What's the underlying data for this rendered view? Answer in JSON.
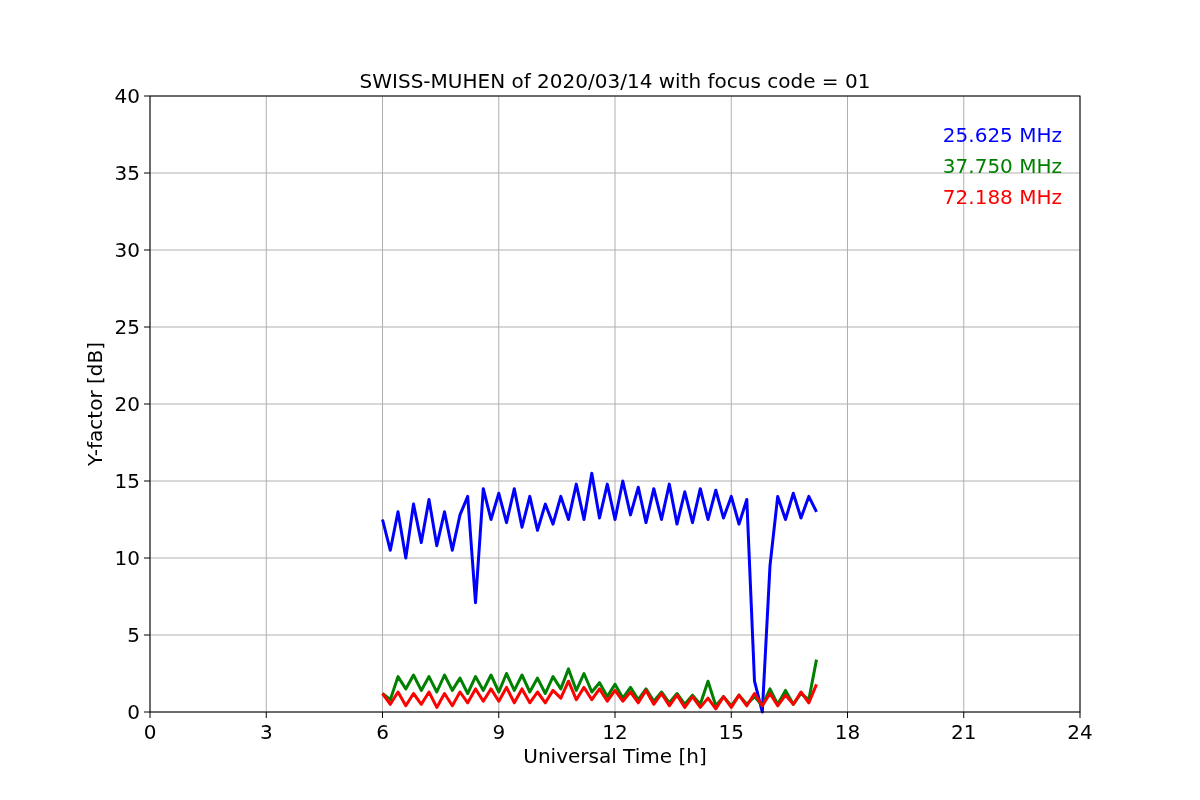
{
  "plot": {
    "chart_data": {
      "type": "line",
      "title": "SWISS-MUHEN of 2020/03/14 with focus code = 01",
      "xlabel": "Universal Time [h]",
      "ylabel": "Y-factor [dB]",
      "x": [
        6,
        6.2,
        6.4,
        6.6,
        6.8,
        7,
        7.2,
        7.4,
        7.6,
        7.8,
        8,
        8.2,
        8.4,
        8.6,
        8.8,
        9,
        9.2,
        9.4,
        9.6,
        9.8,
        10,
        10.2,
        10.4,
        10.6,
        10.8,
        11,
        11.2,
        11.4,
        11.6,
        11.8,
        12,
        12.2,
        12.4,
        12.6,
        12.8,
        13,
        13.2,
        13.4,
        13.6,
        13.8,
        14,
        14.2,
        14.4,
        14.6,
        14.8,
        15,
        15.2,
        15.4,
        15.6,
        15.8,
        16,
        16.2,
        16.4,
        16.6,
        16.8,
        17,
        17.2
      ],
      "series": [
        {
          "name": "25.625 MHz",
          "color": "#0000ff",
          "values": [
            12.5,
            10.5,
            13,
            10,
            13.5,
            11,
            13.8,
            10.8,
            13,
            10.5,
            12.8,
            14,
            7.1,
            14.5,
            12.5,
            14.2,
            12.3,
            14.5,
            12,
            14,
            11.8,
            13.5,
            12.2,
            14,
            12.5,
            14.8,
            12.5,
            15.5,
            12.6,
            14.8,
            12.5,
            15,
            12.8,
            14.6,
            12.3,
            14.5,
            12.5,
            14.8,
            12.2,
            14.3,
            12.3,
            14.5,
            12.5,
            14.4,
            12.6,
            14,
            12.2,
            13.8,
            2,
            0,
            9.5,
            14,
            12.5,
            14.2,
            12.6,
            14,
            13
          ]
        },
        {
          "name": "37.750 MHz",
          "color": "#008000",
          "values": [
            1.2,
            0.8,
            2.3,
            1.5,
            2.4,
            1.4,
            2.3,
            1.3,
            2.4,
            1.4,
            2.2,
            1.2,
            2.3,
            1.4,
            2.4,
            1.3,
            2.5,
            1.4,
            2.4,
            1.3,
            2.2,
            1.2,
            2.3,
            1.5,
            2.8,
            1.4,
            2.5,
            1.3,
            1.9,
            1,
            1.8,
            0.9,
            1.6,
            0.8,
            1.5,
            0.7,
            1.3,
            0.6,
            1.2,
            0.5,
            1.1,
            0.5,
            2,
            0.4,
            1,
            0.4,
            1.1,
            0.5,
            1,
            0.4,
            1.5,
            0.5,
            1.4,
            0.5,
            1.2,
            0.8,
            3.4
          ]
        },
        {
          "name": "72.188 MHz",
          "color": "#ff0000",
          "values": [
            1.2,
            0.5,
            1.3,
            0.4,
            1.2,
            0.5,
            1.3,
            0.3,
            1.2,
            0.4,
            1.3,
            0.6,
            1.5,
            0.7,
            1.5,
            0.7,
            1.6,
            0.6,
            1.5,
            0.6,
            1.3,
            0.6,
            1.4,
            0.9,
            2,
            0.8,
            1.6,
            0.8,
            1.5,
            0.7,
            1.4,
            0.7,
            1.3,
            0.6,
            1.4,
            0.5,
            1.2,
            0.4,
            1.1,
            0.3,
            1,
            0.3,
            0.9,
            0.2,
            1,
            0.3,
            1.1,
            0.4,
            1.2,
            0.4,
            1.2,
            0.4,
            1.1,
            0.5,
            1.3,
            0.6,
            1.8
          ]
        }
      ],
      "xlim": [
        0,
        24
      ],
      "ylim": [
        0,
        40
      ],
      "xticks": [
        0,
        3,
        6,
        9,
        12,
        15,
        18,
        21,
        24
      ],
      "yticks": [
        0,
        5,
        10,
        15,
        20,
        25,
        30,
        35,
        40
      ],
      "grid": true
    }
  }
}
